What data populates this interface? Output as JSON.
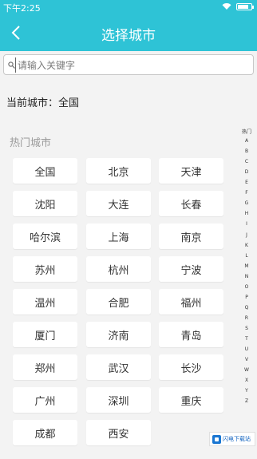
{
  "status_bar": {
    "time": "下午2:25"
  },
  "nav": {
    "title": "选择城市"
  },
  "search": {
    "placeholder": "请输入关键字"
  },
  "current_city": {
    "text": "当前城市：全国"
  },
  "hot_cities": {
    "title": "热门城市",
    "cities": [
      "全国",
      "北京",
      "天津",
      "沈阳",
      "大连",
      "长春",
      "哈尔滨",
      "上海",
      "南京",
      "苏州",
      "杭州",
      "宁波",
      "温州",
      "合肥",
      "福州",
      "厦门",
      "济南",
      "青岛",
      "郑州",
      "武汉",
      "长沙",
      "广州",
      "深圳",
      "重庆",
      "成都",
      "西安"
    ]
  },
  "index_bar": {
    "items": [
      "热门",
      "A",
      "B",
      "C",
      "D",
      "E",
      "F",
      "G",
      "H",
      "I",
      "J",
      "K",
      "L",
      "M",
      "N",
      "O",
      "P",
      "Q",
      "R",
      "S",
      "T",
      "U",
      "V",
      "W",
      "X",
      "Y",
      "Z"
    ]
  },
  "watermark": {
    "text": "闪电下载站"
  },
  "colors": {
    "accent": "#2ec3d6",
    "background": "#f3f3f3"
  }
}
